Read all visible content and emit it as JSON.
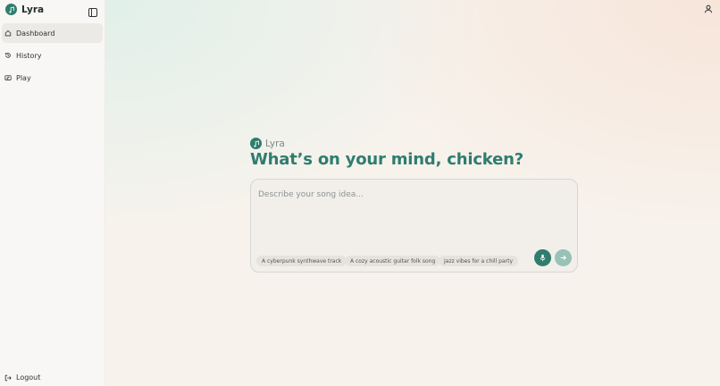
{
  "app": {
    "name": "Lyra"
  },
  "sidebar": {
    "items": [
      {
        "label": "Dashboard",
        "icon": "home-icon",
        "active": true
      },
      {
        "label": "History",
        "icon": "history-icon",
        "active": false
      },
      {
        "label": "Play",
        "icon": "music-library-icon",
        "active": false
      }
    ],
    "logout_label": "Logout"
  },
  "main": {
    "brand_label": "Lyra",
    "headline": "What’s on your mind, chicken?",
    "prompt": {
      "placeholder": "Describe your song idea...",
      "value": ""
    },
    "suggestions": [
      "A cyberpunk synthwave track",
      "A cozy acoustic guitar folk song",
      "Jazz vibes for a chill party"
    ]
  },
  "colors": {
    "accent": "#2f7d6d",
    "accent_muted": "#97c2b5"
  }
}
